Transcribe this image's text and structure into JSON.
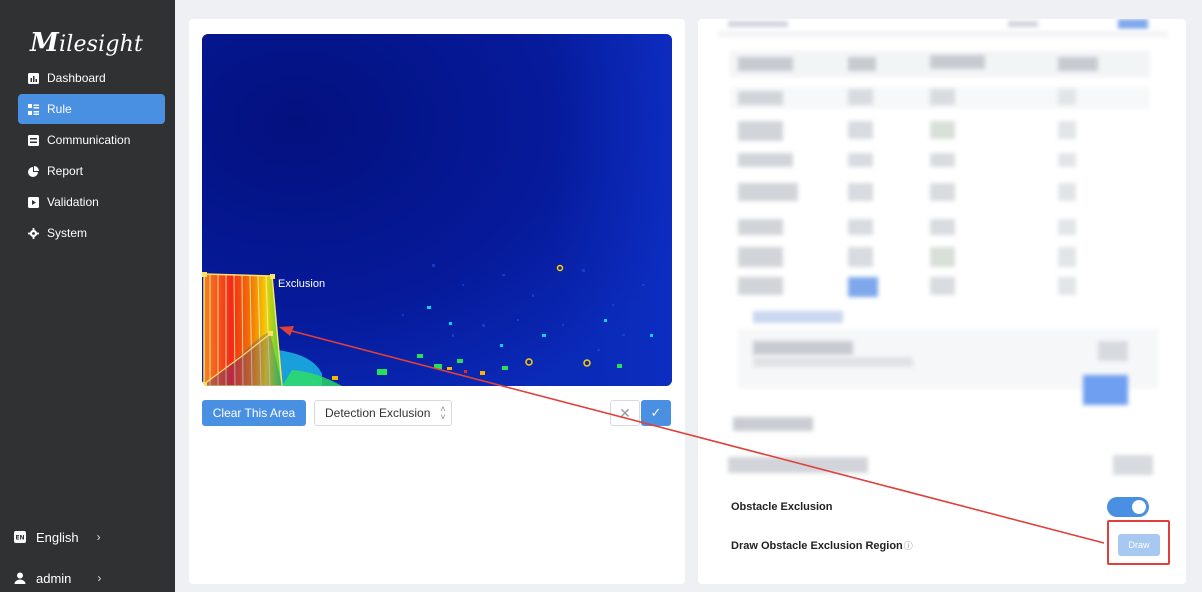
{
  "sidebar": {
    "logo": {
      "initial": "M",
      "rest": "ilesight"
    },
    "items": [
      {
        "label": "Dashboard",
        "icon": "chart-icon"
      },
      {
        "label": "Rule",
        "icon": "rule-icon",
        "active": true
      },
      {
        "label": "Communication",
        "icon": "communication-icon"
      },
      {
        "label": "Report",
        "icon": "pie-chart-icon"
      },
      {
        "label": "Validation",
        "icon": "validation-icon"
      },
      {
        "label": "System",
        "icon": "gear-icon"
      }
    ],
    "language": "English",
    "user": "admin",
    "chevron": "›"
  },
  "editor": {
    "region_label": "Exclusion",
    "clear_button": "Clear This Area",
    "area_type": "Detection Exclusion",
    "cancel_icon": "close-icon",
    "confirm_icon": "check-icon"
  },
  "settings": {
    "obstacle_exclusion_label": "Obstacle Exclusion",
    "obstacle_exclusion_enabled": true,
    "draw_region_label": "Draw Obstacle Exclusion Region",
    "info_icon": "ⓘ",
    "draw_button": "Draw"
  },
  "colors": {
    "sidebar_bg": "#2f3133",
    "accent": "#4a90e2",
    "highlight": "#e0403a",
    "heatmap_bg": "#05138a"
  }
}
